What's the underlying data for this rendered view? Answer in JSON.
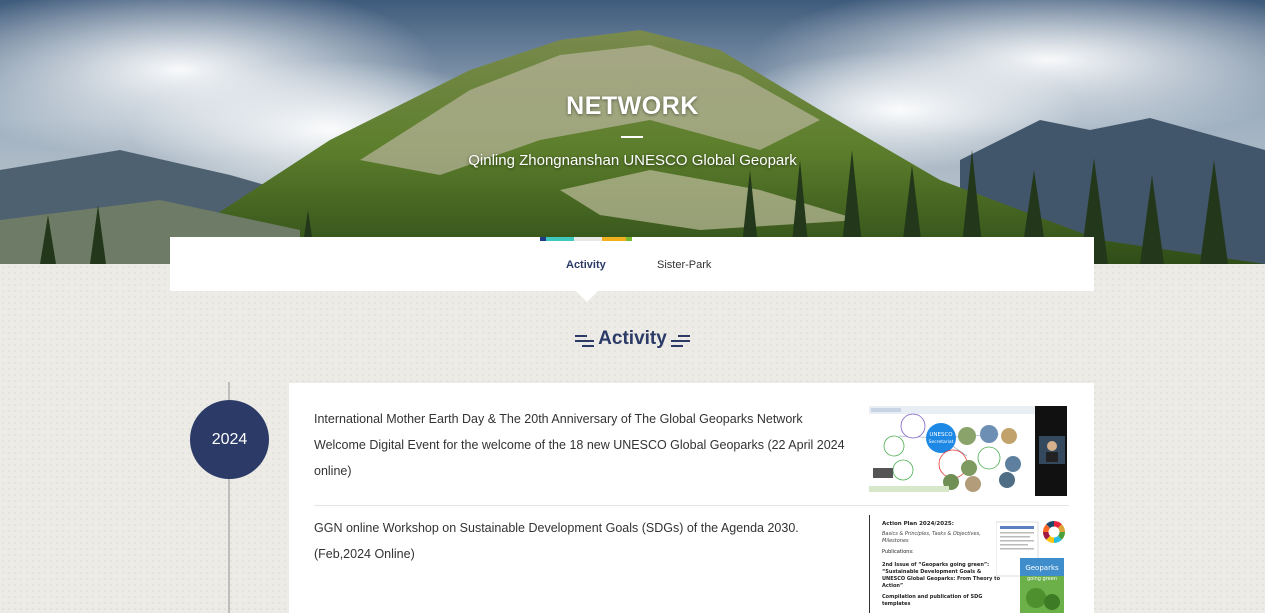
{
  "hero": {
    "title": "NETWORK",
    "subtitle": "Qinling Zhongnanshan UNESCO Global Geopark"
  },
  "tabs": [
    {
      "label": "Activity",
      "active": true
    },
    {
      "label": "Sister-Park",
      "active": false
    }
  ],
  "tab_colorbar": [
    "#1f3c8a",
    "#3ec9c0",
    "#e8e8e8",
    "#f2b01e",
    "#78b832"
  ],
  "section": {
    "title": "Activity"
  },
  "timeline": {
    "year": "2024",
    "items": [
      {
        "text": "International Mother Earth Day & The 20th Anniversary of The Global Geoparks Network Welcome Digital Event for the welcome of the 18 new UNESCO Global Geoparks (22 April 2024 online)",
        "thumbnail": {
          "center_label": "UNESCO Secretariat",
          "icon": "video-call-screenshot-icon"
        }
      },
      {
        "text": "GGN online Workshop on Sustainable Development Goals (SDGs) of the Agenda 2030. (Feb,2024 Online)",
        "thumbnail": {
          "heading": "Action Plan 2024/2025:",
          "line1": "Basics & Principles, Tasks & Objectives, Milestones",
          "line2": "Publications:",
          "line3": "2nd Issue of “Geoparks going green”:",
          "line4": "“Sustainable Development Goals & UNESCO Global Geoparks: From Theory to Action”",
          "line5": "Compilation and publication of SDG templates",
          "book_title": "Geoparks going green",
          "icon": "sdg-wheel-icon"
        }
      }
    ]
  }
}
